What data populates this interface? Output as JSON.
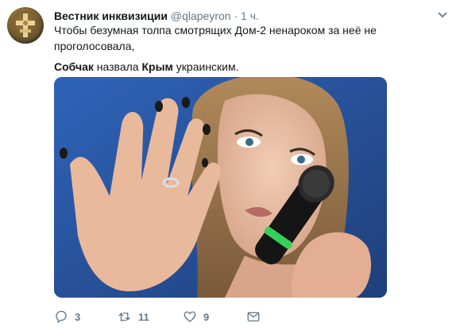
{
  "tweet": {
    "author_name": "Вестник инквизиции",
    "handle": "@qlapeyron",
    "separator": "·",
    "time": "1 ч.",
    "text_line1": "Чтобы безумная толпа смотрящих Дом-2 ненароком за неё не",
    "text_line2": "проголосовала,",
    "text_line3_bold1": "Собчак",
    "text_line3_mid": " назвала ",
    "text_line3_bold2": "Крым",
    "text_line3_end": " украинским."
  },
  "actions": {
    "reply_count": "3",
    "retweet_count": "11",
    "like_count": "9"
  },
  "colors": {
    "text": "#14171a",
    "muted": "#657786",
    "media_background": "#2d5fb0"
  },
  "icons": [
    "avatar-cross-emblem",
    "chevron-down-icon",
    "reply-icon",
    "retweet-icon",
    "like-icon",
    "direct-message-icon"
  ]
}
